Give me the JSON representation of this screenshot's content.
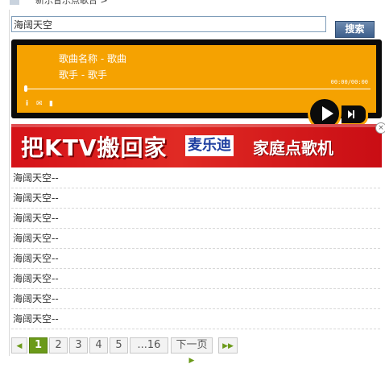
{
  "breadcrumb": {
    "text": "新乐音乐点歌台 >"
  },
  "search": {
    "value": "海阔天空",
    "button_label": "搜索"
  },
  "player": {
    "song_title": "歌曲名称 - 歌曲",
    "artist": "歌手 - 歌手",
    "time": "00:00/00:00",
    "progress": 0,
    "icons": {
      "info": "i",
      "mail": "✉",
      "volume": "▮"
    },
    "accent": "#f5a201"
  },
  "banner": {
    "main_text": "把KTV搬回家",
    "brand_text": "麦乐迪",
    "sub_text": "家庭点歌机",
    "close_label": "×",
    "color": "#d51218"
  },
  "results": [
    "海阔天空--",
    "海阔天空--",
    "海阔天空--",
    "海阔天空--",
    "海阔天空--",
    "海阔天空--",
    "海阔天空--",
    "海阔天空--"
  ],
  "pager": {
    "prev_icon": "◀",
    "pages": [
      "1",
      "2",
      "3",
      "4",
      "5"
    ],
    "ellipsis_last": "...16",
    "next_label": "下一页",
    "next_icon": "▶",
    "last_icon": "▶▶",
    "current": "1",
    "accent": "#6b9a1a"
  }
}
